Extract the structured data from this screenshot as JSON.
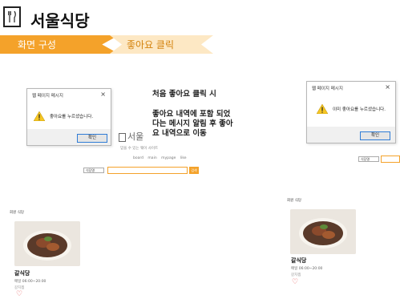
{
  "header": {
    "title": "서울식당"
  },
  "tabs": {
    "tab1": "화면 구성",
    "tab2": "좋아요 클릭"
  },
  "dialog_left": {
    "title": "웹 페이지 메시지",
    "message": "좋아요를 누르셨습니다.",
    "ok": "확인",
    "close": "×"
  },
  "dialog_right": {
    "title": "웹 페이지 메시지",
    "message": "이미 좋아요를 누르셨습니다.",
    "ok": "확인",
    "close": "×"
  },
  "annotation": {
    "line1": "처음 좋아요 클릭 시",
    "line2": "좋아요 내역에 포함 되었",
    "line3": "다는 메시지 알림 후 좋아",
    "line4": "요 내역으로 이동"
  },
  "center": {
    "logo_text": "서울",
    "tagline": "믿을 수 있는 웨이 사이트",
    "nav": "board  main  mypage  like",
    "select_left": "식당명",
    "select_right": "식당명",
    "search_button": "검색"
  },
  "list_left": {
    "section": "회원 식당",
    "food_name": "갈식당",
    "hours": "매일 06:00~20:00",
    "category": "갈치찜",
    "heart": "♡"
  },
  "list_right": {
    "section": "회원 식당",
    "food_name": "갈식당",
    "hours": "매일 06:00~20:00",
    "category": "갈치찜",
    "heart": "♡"
  },
  "colors": {
    "accent": "#f4a22a",
    "accent_light": "#fde8c4",
    "heart": "#e34c4c"
  }
}
